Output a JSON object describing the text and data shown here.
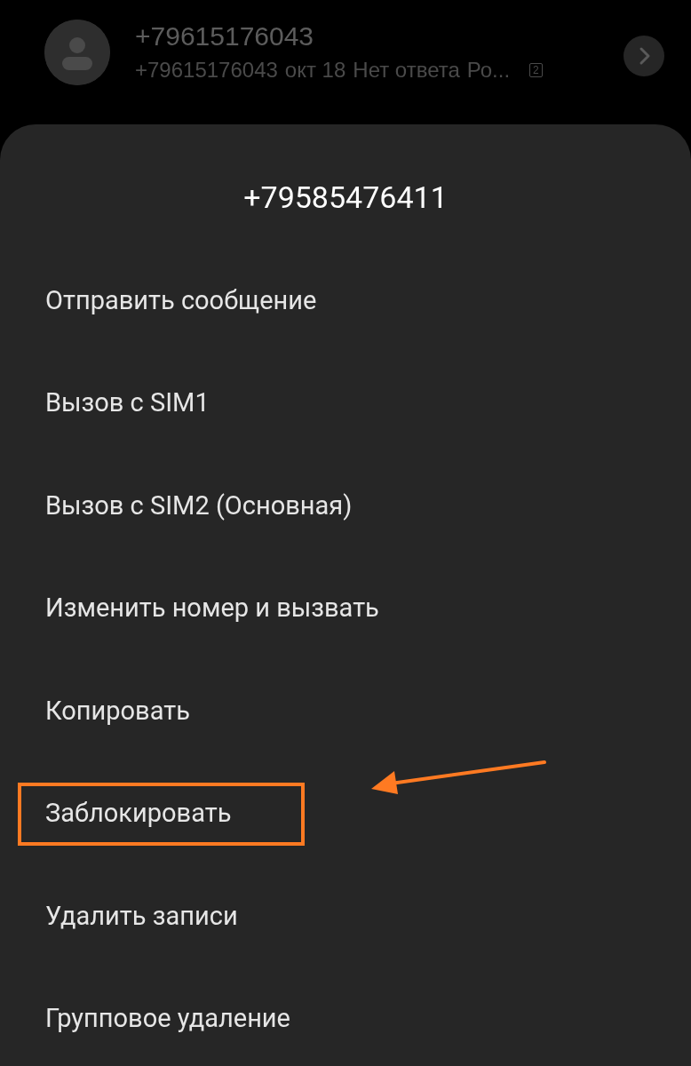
{
  "background_call": {
    "number": "+79615176043",
    "detail_number": "+79615176043",
    "date": "окт 18",
    "status": "Нет ответа",
    "location": "Ро...",
    "sim": "2"
  },
  "menu": {
    "title": "+79585476411",
    "items": [
      {
        "label": "Отправить сообщение",
        "highlighted": false
      },
      {
        "label": "Вызов с SIM1",
        "highlighted": false
      },
      {
        "label": "Вызов с SIM2 (Основная)",
        "highlighted": false
      },
      {
        "label": "Изменить номер и вызвать",
        "highlighted": false
      },
      {
        "label": "Копировать",
        "highlighted": false
      },
      {
        "label": "Заблокировать",
        "highlighted": true
      },
      {
        "label": "Удалить записи",
        "highlighted": false
      },
      {
        "label": "Групповое удаление",
        "highlighted": false
      }
    ]
  }
}
